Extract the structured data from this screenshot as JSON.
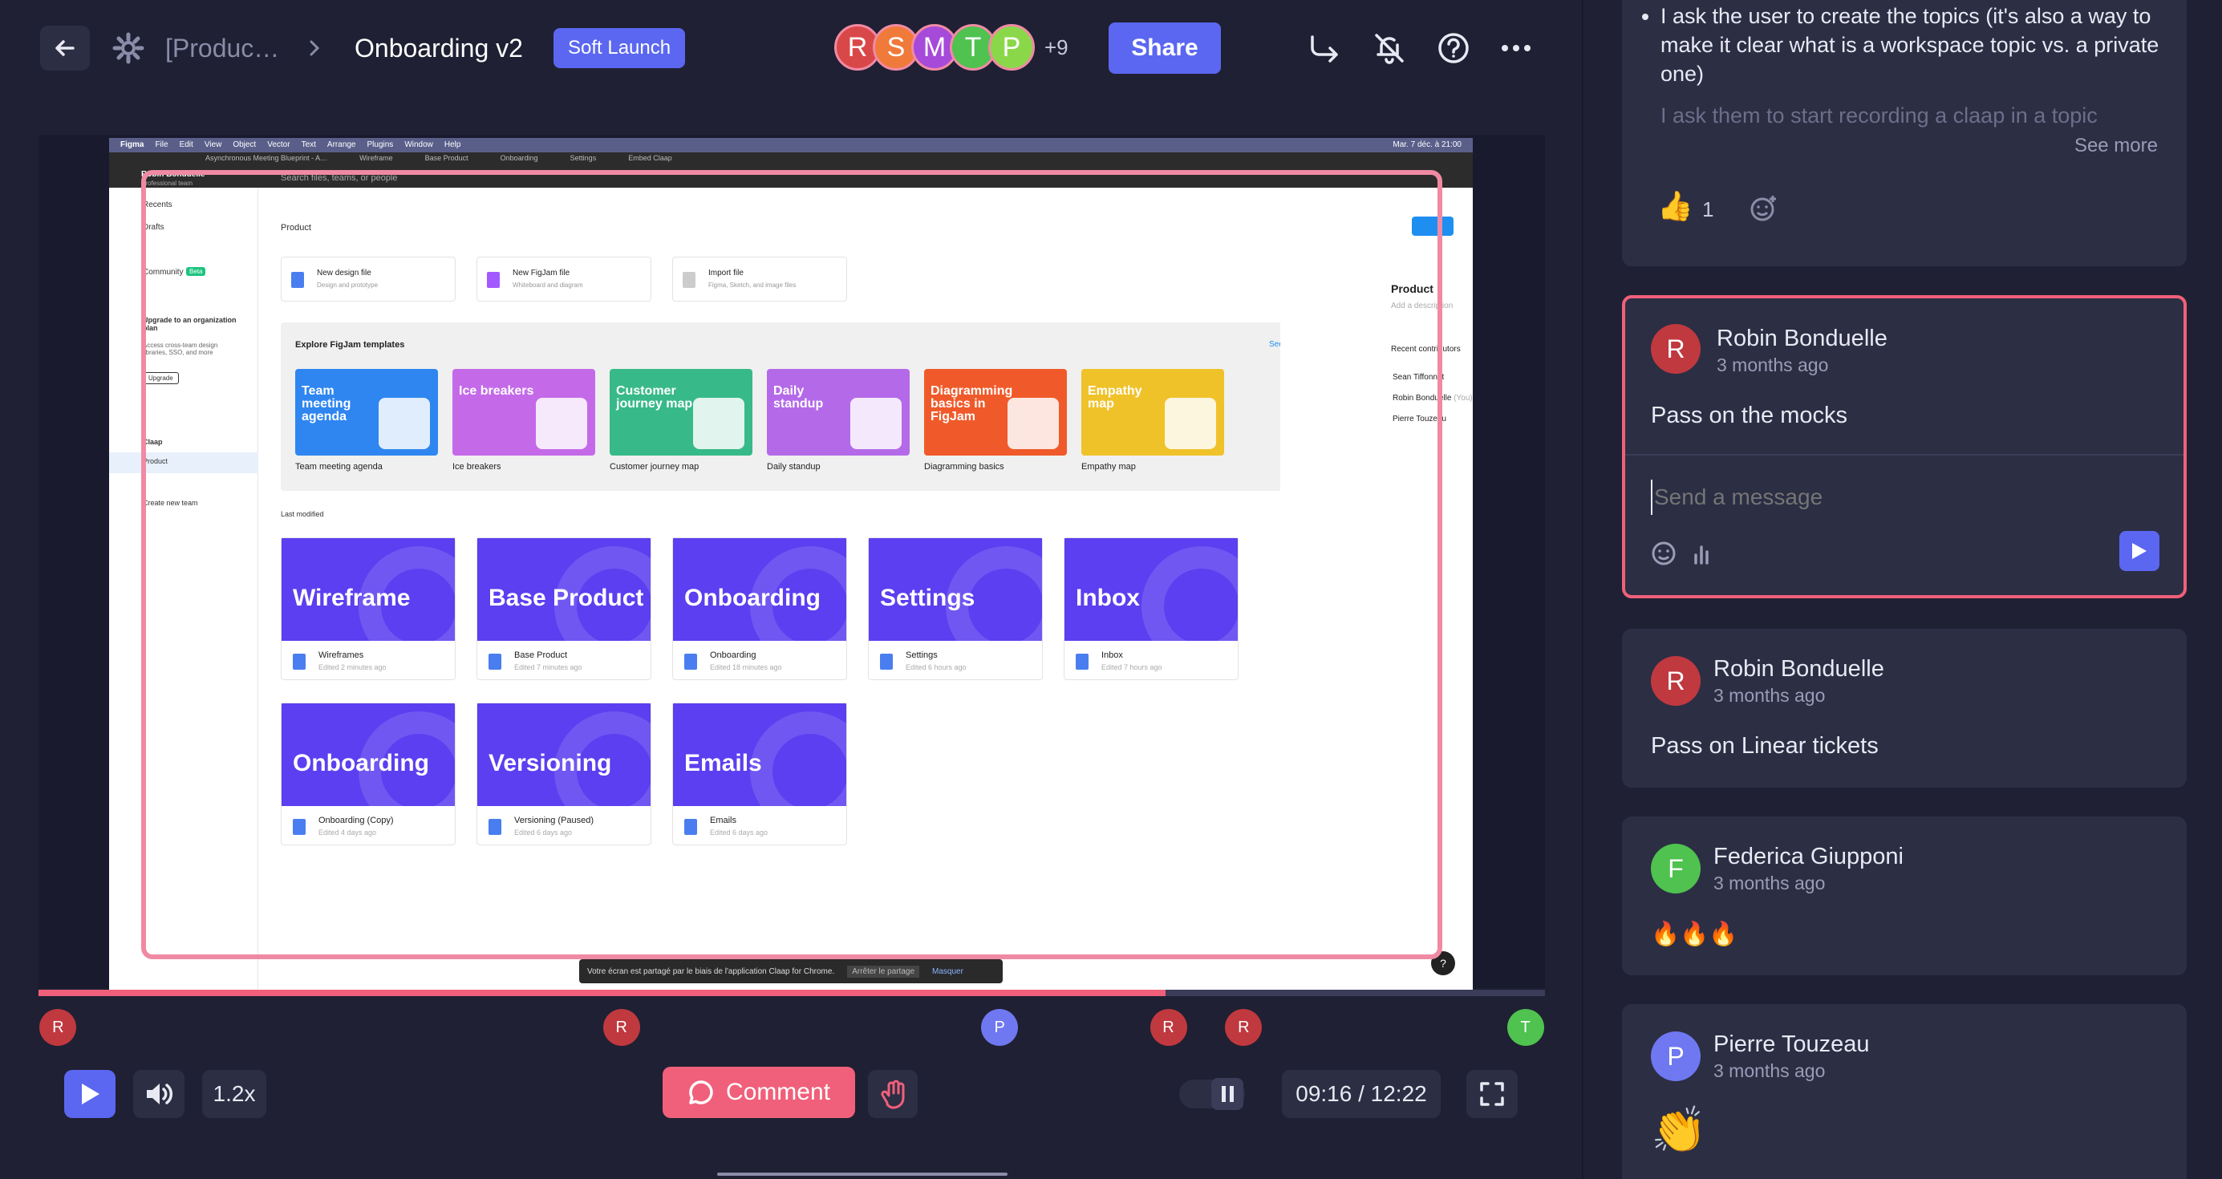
{
  "header": {
    "breadcrumb_parent": "[Produc…",
    "title": "Onboarding v2",
    "tag": "Soft Launch",
    "avatars": [
      {
        "initial": "R",
        "color": "#d94848"
      },
      {
        "initial": "S",
        "color": "#f07a3a"
      },
      {
        "initial": "M",
        "color": "#a64ad9"
      },
      {
        "initial": "T",
        "color": "#4fc24f"
      },
      {
        "initial": "P",
        "color": "#8ad84a"
      }
    ],
    "extra_count": "+9",
    "share_label": "Share"
  },
  "recording": {
    "mac_menu": [
      "Figma",
      "File",
      "Edit",
      "View",
      "Object",
      "Vector",
      "Text",
      "Arrange",
      "Plugins",
      "Window",
      "Help"
    ],
    "mac_clock": "Mar. 7 déc. à 21:00",
    "tabs": [
      "Asynchronous Meeting Blueprint - A…",
      "Wireframe",
      "Base Product",
      "Onboarding",
      "Settings",
      "Embed Claap"
    ],
    "team_name": "Robin Bonduelle",
    "team_sub": "Professional team",
    "search_placeholder": "Search files, teams, or people",
    "sidebar": [
      "Recents",
      "Drafts",
      "Community",
      "Upgrade to an organization plan",
      "Access cross-team design libraries, SSO, and more",
      "Upgrade",
      "Claap",
      "Product",
      "Create new team"
    ],
    "community_badge": "Beta",
    "project_title": "Product",
    "actions": [
      {
        "title": "New design file",
        "sub": "Design and prototype"
      },
      {
        "title": "New FigJam file",
        "sub": "Whiteboard and diagram"
      },
      {
        "title": "Import file",
        "sub": "Figma, Sketch, and image files"
      }
    ],
    "explore_title": "Explore FigJam templates",
    "see_all": "See all",
    "templates": [
      {
        "title": "Team meeting agenda",
        "label": "Team meeting agenda",
        "color": "#2f86f0"
      },
      {
        "title": "Ice breakers",
        "label": "Ice breakers",
        "color": "#c46ae8"
      },
      {
        "title": "Customer journey map",
        "label": "Customer journey map",
        "color": "#38b98a"
      },
      {
        "title": "Daily standup",
        "label": "Daily standup",
        "color": "#b46ae8"
      },
      {
        "title": "Diagramming basics in FigJam",
        "label": "Diagramming basics",
        "color": "#f05a2a"
      },
      {
        "title": "Empathy map",
        "label": "Empathy map",
        "color": "#f0c22a"
      }
    ],
    "last_modified": "Last modified",
    "files": [
      {
        "title": "Wireframe",
        "name": "Wireframes",
        "edited": "Edited 2 minutes ago"
      },
      {
        "title": "Base Product",
        "name": "Base Product",
        "edited": "Edited 7 minutes ago"
      },
      {
        "title": "Onboarding",
        "name": "Onboarding",
        "edited": "Edited 18 minutes ago"
      },
      {
        "title": "Settings",
        "name": "Settings",
        "edited": "Edited 6 hours ago"
      },
      {
        "title": "Inbox",
        "name": "Inbox",
        "edited": "Edited 7 hours ago"
      },
      {
        "title": "Onboarding",
        "name": "Onboarding (Copy)",
        "edited": "Edited 4 days ago"
      },
      {
        "title": "Versioning",
        "name": "Versioning (Paused)",
        "edited": "Edited 6 days ago"
      },
      {
        "title": "Emails",
        "name": "Emails",
        "edited": "Edited 6 days ago"
      }
    ],
    "panel_title": "Product",
    "panel_desc": "Add a description",
    "contributors_title": "Recent contributors",
    "contributors": [
      "Sean Tiffonnet",
      "Robin Bonduelle",
      "Pierre Touzeau"
    ],
    "you_label": "(You)",
    "share_bar": {
      "text": "Votre écran est partagé par le biais de l'application Claap for Chrome.",
      "stop": "Arrêter le partage",
      "hide": "Masquer"
    }
  },
  "timeline": {
    "progress": 0.748,
    "markers": [
      {
        "initial": "R",
        "color": "#c0393f",
        "pos": 0.013
      },
      {
        "initial": "R",
        "color": "#c0393f",
        "pos": 0.387
      },
      {
        "initial": "P",
        "color": "#6f78f0",
        "pos": 0.638
      },
      {
        "initial": "R",
        "color": "#c0393f",
        "pos": 0.75
      },
      {
        "initial": "R",
        "color": "#c0393f",
        "pos": 0.8
      },
      {
        "initial": "T",
        "color": "#4fc24f",
        "pos": 0.987
      }
    ]
  },
  "controls": {
    "speed": "1.2x",
    "comment_label": "Comment",
    "time": "09:16 / 12:22"
  },
  "comments": {
    "top_bullets": [
      "I ask the user to create the topics (it's also a way to make it clear what is a workspace topic vs. a private one)",
      "I ask them to start recording a claap in a topic"
    ],
    "see_more": "See more",
    "reaction_count": "1",
    "active": {
      "initial": "R",
      "name": "Robin Bonduelle",
      "time": "3 months ago",
      "text": "Pass on the mocks",
      "reply_placeholder": "Send a message"
    },
    "list": [
      {
        "initial": "R",
        "color": "#c0393f",
        "name": "Robin Bonduelle",
        "time": "3 months ago",
        "text": "Pass on Linear tickets"
      },
      {
        "initial": "F",
        "color": "#4fc24f",
        "name": "Federica Giupponi",
        "time": "3 months ago",
        "text": "🔥🔥🔥"
      },
      {
        "initial": "P",
        "color": "#6f78f0",
        "name": "Pierre Touzeau",
        "time": "3 months ago",
        "text": "👏"
      }
    ]
  }
}
